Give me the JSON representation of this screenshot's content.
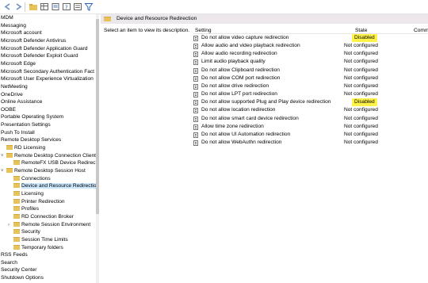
{
  "toolbar": {
    "icons": [
      "back-icon",
      "forward-icon",
      "open-folder-icon",
      "grid-view-icon",
      "export-list-icon",
      "help-icon",
      "properties-icon",
      "filter-icon"
    ]
  },
  "tree": {
    "items": [
      {
        "label": "MDM",
        "indent": 0,
        "folder": false
      },
      {
        "label": "Messaging",
        "indent": 0,
        "folder": false
      },
      {
        "label": "Microsoft account",
        "indent": 0,
        "folder": false
      },
      {
        "label": "Microsoft Defender Antivirus",
        "indent": 0,
        "folder": false
      },
      {
        "label": "Microsoft Defender Application Guard",
        "indent": 0,
        "folder": false
      },
      {
        "label": "Microsoft Defender Exploit Guard",
        "indent": 0,
        "folder": false
      },
      {
        "label": "Microsoft Edge",
        "indent": 0,
        "folder": false
      },
      {
        "label": "Microsoft Secondary Authentication Fact",
        "indent": 0,
        "folder": false
      },
      {
        "label": "Microsoft User Experience Virtualization",
        "indent": 0,
        "folder": false
      },
      {
        "label": "NetMeeting",
        "indent": 0,
        "folder": false
      },
      {
        "label": "OneDrive",
        "indent": 0,
        "folder": false
      },
      {
        "label": "Online Assistance",
        "indent": 0,
        "folder": false
      },
      {
        "label": "OOBE",
        "indent": 0,
        "folder": false
      },
      {
        "label": "Portable Operating System",
        "indent": 0,
        "folder": false
      },
      {
        "label": "Presentation Settings",
        "indent": 0,
        "folder": false
      },
      {
        "label": "Push To Install",
        "indent": 0,
        "folder": false
      },
      {
        "label": "Remote Desktop Services",
        "indent": 0,
        "folder": false
      },
      {
        "label": "RD Licensing",
        "indent": 1,
        "folder": true
      },
      {
        "label": "Remote Desktop Connection Client",
        "indent": 1,
        "folder": true,
        "expanded": true
      },
      {
        "label": "RemoteFX USB Device Redirection",
        "indent": 2,
        "folder": true
      },
      {
        "label": "Remote Desktop Session Host",
        "indent": 1,
        "folder": true,
        "expanded": true
      },
      {
        "label": "Connections",
        "indent": 2,
        "folder": true
      },
      {
        "label": "Device and Resource Redirection",
        "indent": 2,
        "folder": true,
        "selected": true
      },
      {
        "label": "Licensing",
        "indent": 2,
        "folder": true
      },
      {
        "label": "Printer Redirection",
        "indent": 2,
        "folder": true
      },
      {
        "label": "Profiles",
        "indent": 2,
        "folder": true
      },
      {
        "label": "RD Connection Broker",
        "indent": 2,
        "folder": true
      },
      {
        "label": "Remote Session Environment",
        "indent": 2,
        "folder": true,
        "collapsed": true
      },
      {
        "label": "Security",
        "indent": 2,
        "folder": true
      },
      {
        "label": "Session Time Limits",
        "indent": 2,
        "folder": true
      },
      {
        "label": "Temporary folders",
        "indent": 2,
        "folder": true
      },
      {
        "label": "RSS Feeds",
        "indent": 0,
        "folder": false
      },
      {
        "label": "Search",
        "indent": 0,
        "folder": false
      },
      {
        "label": "Security Center",
        "indent": 0,
        "folder": false
      },
      {
        "label": "Shutdown Options",
        "indent": 0,
        "folder": false
      }
    ]
  },
  "pane": {
    "title": "Device and Resource Redirection",
    "description": "Select an item to view its description.",
    "columns": {
      "setting": "Setting",
      "state": "State",
      "comment": "Comm"
    }
  },
  "settings": [
    {
      "name": "Do not allow video capture redirection",
      "state": "Disabled",
      "highlighted": true
    },
    {
      "name": "Allow audio and video playback redirection",
      "state": "Not configured"
    },
    {
      "name": "Allow audio recording redirection",
      "state": "Not configured"
    },
    {
      "name": "Limit audio playback quality",
      "state": "Not configured"
    },
    {
      "name": "Do not allow Clipboard redirection",
      "state": "Not configured"
    },
    {
      "name": "Do not allow COM port redirection",
      "state": "Not configured"
    },
    {
      "name": "Do not allow drive redirection",
      "state": "Not configured"
    },
    {
      "name": "Do not allow LPT port redirection",
      "state": "Not configured"
    },
    {
      "name": "Do not allow supported Plug and Play device redirection",
      "state": "Disabled",
      "highlighted": true
    },
    {
      "name": "Do not allow location redirection",
      "state": "Not configured"
    },
    {
      "name": "Do not allow smart card device redirection",
      "state": "Not configured"
    },
    {
      "name": "Allow time zone redirection",
      "state": "Not configured"
    },
    {
      "name": "Do not allow UI Automation redirection",
      "state": "Not configured"
    },
    {
      "name": "Do not allow WebAuthn redirection",
      "state": "Not configured"
    }
  ],
  "colors": {
    "highlight": "#fff34a",
    "selection": "#cce8ff",
    "folder": "#e8c25a"
  }
}
